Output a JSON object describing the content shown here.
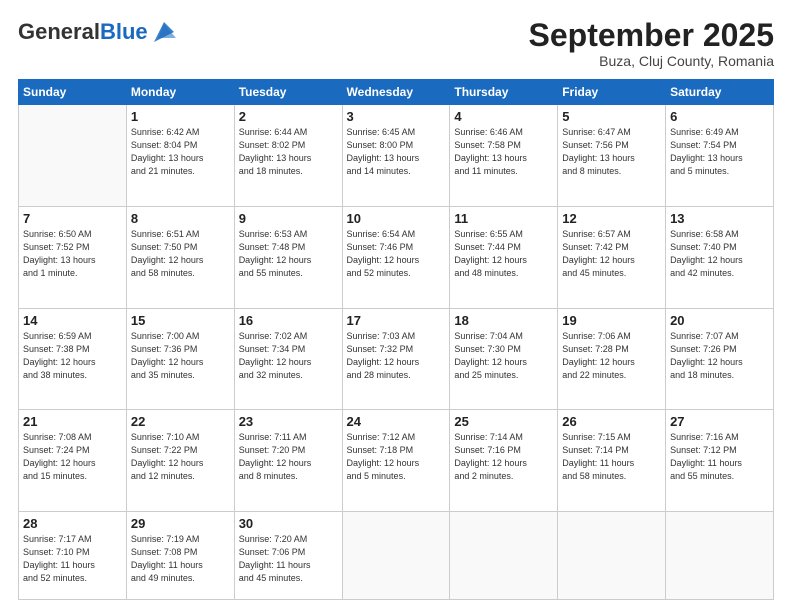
{
  "logo": {
    "general": "General",
    "blue": "Blue"
  },
  "header": {
    "month": "September 2025",
    "location": "Buza, Cluj County, Romania"
  },
  "weekdays": [
    "Sunday",
    "Monday",
    "Tuesday",
    "Wednesday",
    "Thursday",
    "Friday",
    "Saturday"
  ],
  "weeks": [
    [
      {
        "day": "",
        "text": ""
      },
      {
        "day": "1",
        "text": "Sunrise: 6:42 AM\nSunset: 8:04 PM\nDaylight: 13 hours\nand 21 minutes."
      },
      {
        "day": "2",
        "text": "Sunrise: 6:44 AM\nSunset: 8:02 PM\nDaylight: 13 hours\nand 18 minutes."
      },
      {
        "day": "3",
        "text": "Sunrise: 6:45 AM\nSunset: 8:00 PM\nDaylight: 13 hours\nand 14 minutes."
      },
      {
        "day": "4",
        "text": "Sunrise: 6:46 AM\nSunset: 7:58 PM\nDaylight: 13 hours\nand 11 minutes."
      },
      {
        "day": "5",
        "text": "Sunrise: 6:47 AM\nSunset: 7:56 PM\nDaylight: 13 hours\nand 8 minutes."
      },
      {
        "day": "6",
        "text": "Sunrise: 6:49 AM\nSunset: 7:54 PM\nDaylight: 13 hours\nand 5 minutes."
      }
    ],
    [
      {
        "day": "7",
        "text": "Sunrise: 6:50 AM\nSunset: 7:52 PM\nDaylight: 13 hours\nand 1 minute."
      },
      {
        "day": "8",
        "text": "Sunrise: 6:51 AM\nSunset: 7:50 PM\nDaylight: 12 hours\nand 58 minutes."
      },
      {
        "day": "9",
        "text": "Sunrise: 6:53 AM\nSunset: 7:48 PM\nDaylight: 12 hours\nand 55 minutes."
      },
      {
        "day": "10",
        "text": "Sunrise: 6:54 AM\nSunset: 7:46 PM\nDaylight: 12 hours\nand 52 minutes."
      },
      {
        "day": "11",
        "text": "Sunrise: 6:55 AM\nSunset: 7:44 PM\nDaylight: 12 hours\nand 48 minutes."
      },
      {
        "day": "12",
        "text": "Sunrise: 6:57 AM\nSunset: 7:42 PM\nDaylight: 12 hours\nand 45 minutes."
      },
      {
        "day": "13",
        "text": "Sunrise: 6:58 AM\nSunset: 7:40 PM\nDaylight: 12 hours\nand 42 minutes."
      }
    ],
    [
      {
        "day": "14",
        "text": "Sunrise: 6:59 AM\nSunset: 7:38 PM\nDaylight: 12 hours\nand 38 minutes."
      },
      {
        "day": "15",
        "text": "Sunrise: 7:00 AM\nSunset: 7:36 PM\nDaylight: 12 hours\nand 35 minutes."
      },
      {
        "day": "16",
        "text": "Sunrise: 7:02 AM\nSunset: 7:34 PM\nDaylight: 12 hours\nand 32 minutes."
      },
      {
        "day": "17",
        "text": "Sunrise: 7:03 AM\nSunset: 7:32 PM\nDaylight: 12 hours\nand 28 minutes."
      },
      {
        "day": "18",
        "text": "Sunrise: 7:04 AM\nSunset: 7:30 PM\nDaylight: 12 hours\nand 25 minutes."
      },
      {
        "day": "19",
        "text": "Sunrise: 7:06 AM\nSunset: 7:28 PM\nDaylight: 12 hours\nand 22 minutes."
      },
      {
        "day": "20",
        "text": "Sunrise: 7:07 AM\nSunset: 7:26 PM\nDaylight: 12 hours\nand 18 minutes."
      }
    ],
    [
      {
        "day": "21",
        "text": "Sunrise: 7:08 AM\nSunset: 7:24 PM\nDaylight: 12 hours\nand 15 minutes."
      },
      {
        "day": "22",
        "text": "Sunrise: 7:10 AM\nSunset: 7:22 PM\nDaylight: 12 hours\nand 12 minutes."
      },
      {
        "day": "23",
        "text": "Sunrise: 7:11 AM\nSunset: 7:20 PM\nDaylight: 12 hours\nand 8 minutes."
      },
      {
        "day": "24",
        "text": "Sunrise: 7:12 AM\nSunset: 7:18 PM\nDaylight: 12 hours\nand 5 minutes."
      },
      {
        "day": "25",
        "text": "Sunrise: 7:14 AM\nSunset: 7:16 PM\nDaylight: 12 hours\nand 2 minutes."
      },
      {
        "day": "26",
        "text": "Sunrise: 7:15 AM\nSunset: 7:14 PM\nDaylight: 11 hours\nand 58 minutes."
      },
      {
        "day": "27",
        "text": "Sunrise: 7:16 AM\nSunset: 7:12 PM\nDaylight: 11 hours\nand 55 minutes."
      }
    ],
    [
      {
        "day": "28",
        "text": "Sunrise: 7:17 AM\nSunset: 7:10 PM\nDaylight: 11 hours\nand 52 minutes."
      },
      {
        "day": "29",
        "text": "Sunrise: 7:19 AM\nSunset: 7:08 PM\nDaylight: 11 hours\nand 49 minutes."
      },
      {
        "day": "30",
        "text": "Sunrise: 7:20 AM\nSunset: 7:06 PM\nDaylight: 11 hours\nand 45 minutes."
      },
      {
        "day": "",
        "text": ""
      },
      {
        "day": "",
        "text": ""
      },
      {
        "day": "",
        "text": ""
      },
      {
        "day": "",
        "text": ""
      }
    ]
  ]
}
